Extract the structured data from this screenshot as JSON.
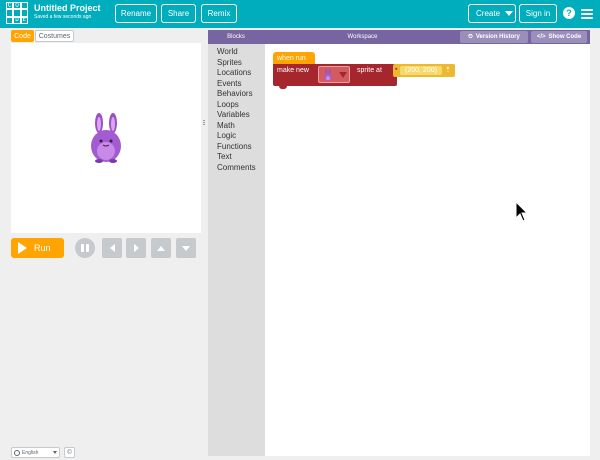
{
  "header": {
    "logo_letters": [
      "C",
      "O",
      "D",
      "E"
    ],
    "project_title": "Untitled Project",
    "saved_status": "Saved a few seconds ago",
    "rename_label": "Rename",
    "share_label": "Share",
    "remix_label": "Remix",
    "create_label": "Create",
    "signin_label": "Sign in",
    "help_label": "?",
    "accent_color": "#00adbc"
  },
  "left_panel": {
    "tabs": [
      {
        "label": "Code",
        "active": true
      },
      {
        "label": "Costumes",
        "active": false
      }
    ],
    "run_label": "Run",
    "run_color": "#ffa400"
  },
  "footer": {
    "language": "English",
    "copyright_symbol": "©"
  },
  "workspace": {
    "blocks_label": "Blocks",
    "title": "Workspace",
    "version_history_label": "Version History",
    "show_code_label": "Show Code",
    "header_color": "#7665a0",
    "toolbox_categories": [
      "World",
      "Sprites",
      "Locations",
      "Events",
      "Behaviors",
      "Loops",
      "Variables",
      "Math",
      "Logic",
      "Functions",
      "Text",
      "Comments"
    ],
    "block_when_run": "when run",
    "block_make_new": "make new",
    "block_sprite_at": "sprite at",
    "block_location": "(200, 200)"
  }
}
